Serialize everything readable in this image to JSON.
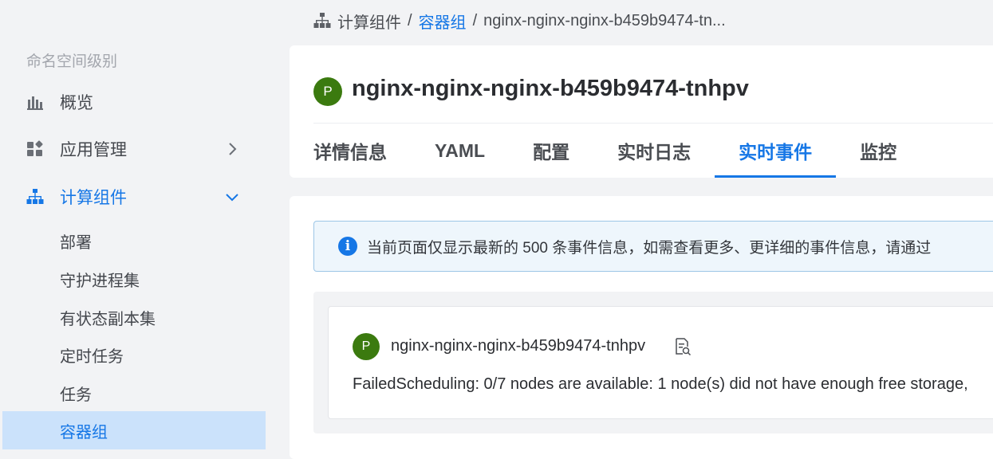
{
  "sidebar": {
    "section_title": "命名空间级别",
    "items": [
      {
        "label": "概览",
        "icon": "bar-chart-icon"
      },
      {
        "label": "应用管理",
        "icon": "app-grid-icon"
      },
      {
        "label": "计算组件",
        "icon": "hierarchy-icon"
      }
    ],
    "sub_items": [
      {
        "label": "部署"
      },
      {
        "label": "守护进程集"
      },
      {
        "label": "有状态副本集"
      },
      {
        "label": "定时任务"
      },
      {
        "label": "任务"
      },
      {
        "label": "容器组"
      }
    ],
    "selected_sub_item": "容器组"
  },
  "breadcrumb": {
    "root": "计算组件",
    "sep1": "/",
    "parent": "容器组",
    "sep2": "/",
    "current": "nginx-nginx-nginx-b459b9474-tn..."
  },
  "header": {
    "badge": "P",
    "title": "nginx-nginx-nginx-b459b9474-tnhpv"
  },
  "tabs": [
    {
      "label": "详情信息"
    },
    {
      "label": "YAML"
    },
    {
      "label": "配置"
    },
    {
      "label": "实时日志"
    },
    {
      "label": "实时事件"
    },
    {
      "label": "监控"
    }
  ],
  "active_tab": "实时事件",
  "alert": {
    "icon_text": "i",
    "text": "当前页面仅显示最新的 500 条事件信息，如需查看更多、更详细的事件信息，请通过"
  },
  "events": [
    {
      "badge": "P",
      "pod_name": "nginx-nginx-nginx-b459b9474-tnhpv",
      "message": "FailedScheduling: 0/7 nodes are available: 1 node(s) did not have enough free storage,"
    }
  ],
  "colors": {
    "accent": "#1677e6",
    "pod_badge": "#3b7a0f",
    "selected_bg": "#cbe2fb",
    "alert_bg": "#eef6fc"
  }
}
